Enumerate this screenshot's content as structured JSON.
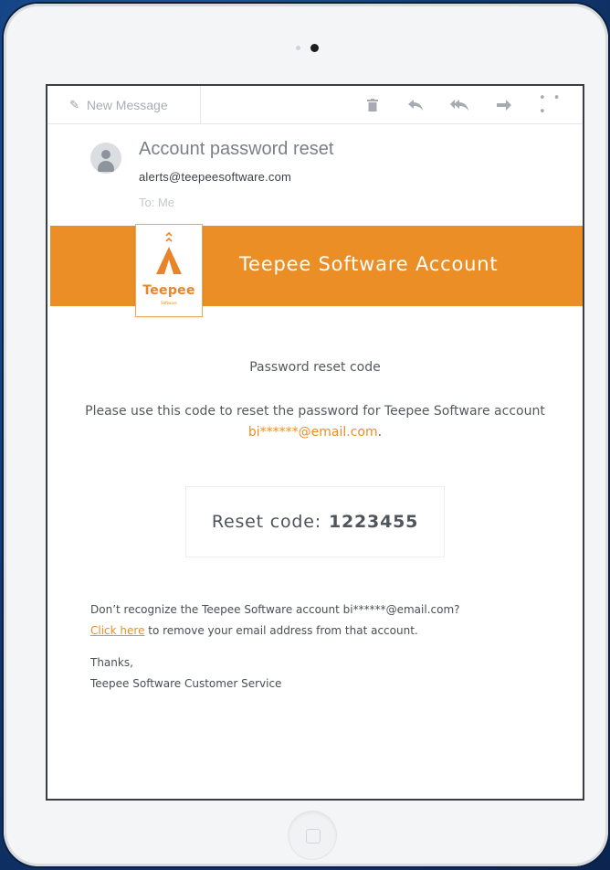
{
  "toolbar": {
    "new_message_label": "New Message",
    "icons": [
      "pencil-icon",
      "trash-icon",
      "reply-icon",
      "reply-all-icon",
      "forward-icon",
      "more-icon"
    ]
  },
  "email": {
    "subject": "Account password reset",
    "from": "alerts@teepeesoftware.com",
    "to": "To: Me"
  },
  "banner": {
    "title": "Teepee Software Account",
    "logo_word": "Teepee",
    "logo_sub": "Software",
    "color": "#eb8e26"
  },
  "body": {
    "heading": "Password reset code",
    "instruction_prefix": "Please use this code to reset the password for Teepee Software account ",
    "masked_email": "bi******@email.com",
    "instruction_suffix": ".",
    "code_label": "Reset code:",
    "code_value": "1223455",
    "unrecognized": "Don’t recognize the Teepee Software account bi******@email.com?",
    "link_text": "Click here",
    "link_suffix": " to remove your email address from that account.",
    "thanks": "Thanks,",
    "signature": "Teepee Software Customer Service"
  }
}
